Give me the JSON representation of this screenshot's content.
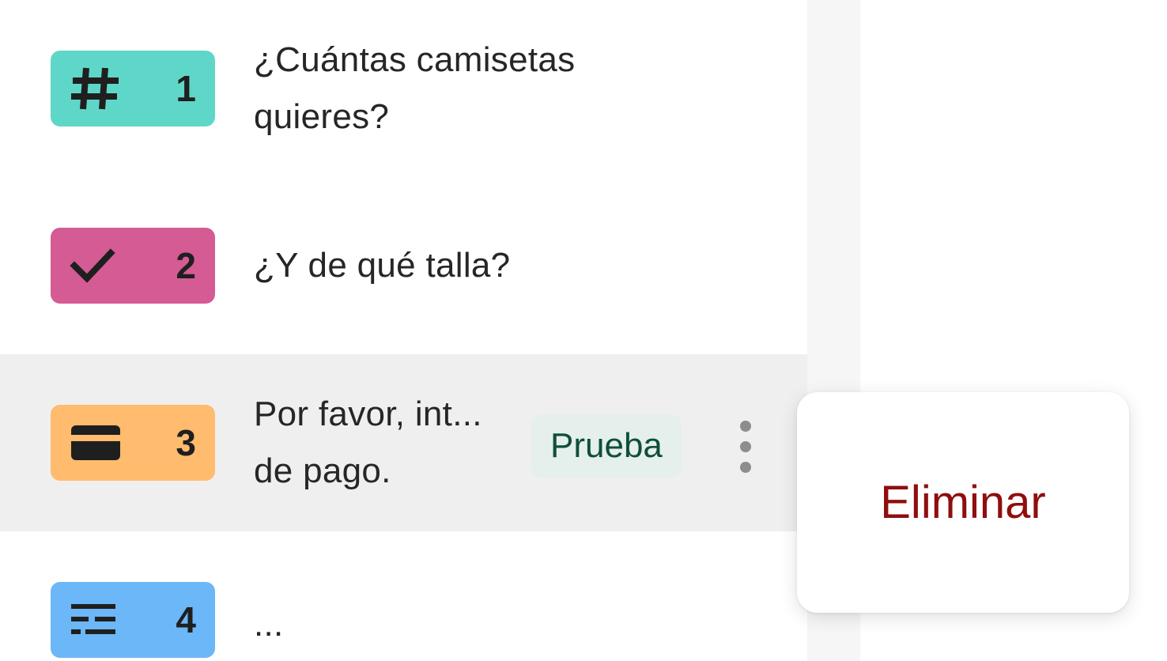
{
  "colors": {
    "number_badge": "#5fd7c8",
    "yesno_badge": "#d45b94",
    "payment_badge": "#ffbb6e",
    "statement_badge": "#6bb7f7",
    "danger_text": "#8f0e0e",
    "tag_bg": "#e5efec",
    "tag_text": "#0e4f3a"
  },
  "questions": [
    {
      "number": "1",
      "icon": "hash-icon",
      "lines": [
        "¿Cuántas camisetas",
        "quieres?"
      ]
    },
    {
      "number": "2",
      "icon": "check-icon",
      "lines": [
        "¿Y de qué talla?"
      ]
    },
    {
      "number": "3",
      "icon": "credit-card-icon",
      "lines": [
        "Por favor, int...",
        "de pago."
      ],
      "tag": "Prueba",
      "selected": true
    },
    {
      "number": "4",
      "icon": "statement-lines-icon",
      "lines": [
        "..."
      ]
    }
  ],
  "context_menu": {
    "delete_label": "Eliminar"
  }
}
